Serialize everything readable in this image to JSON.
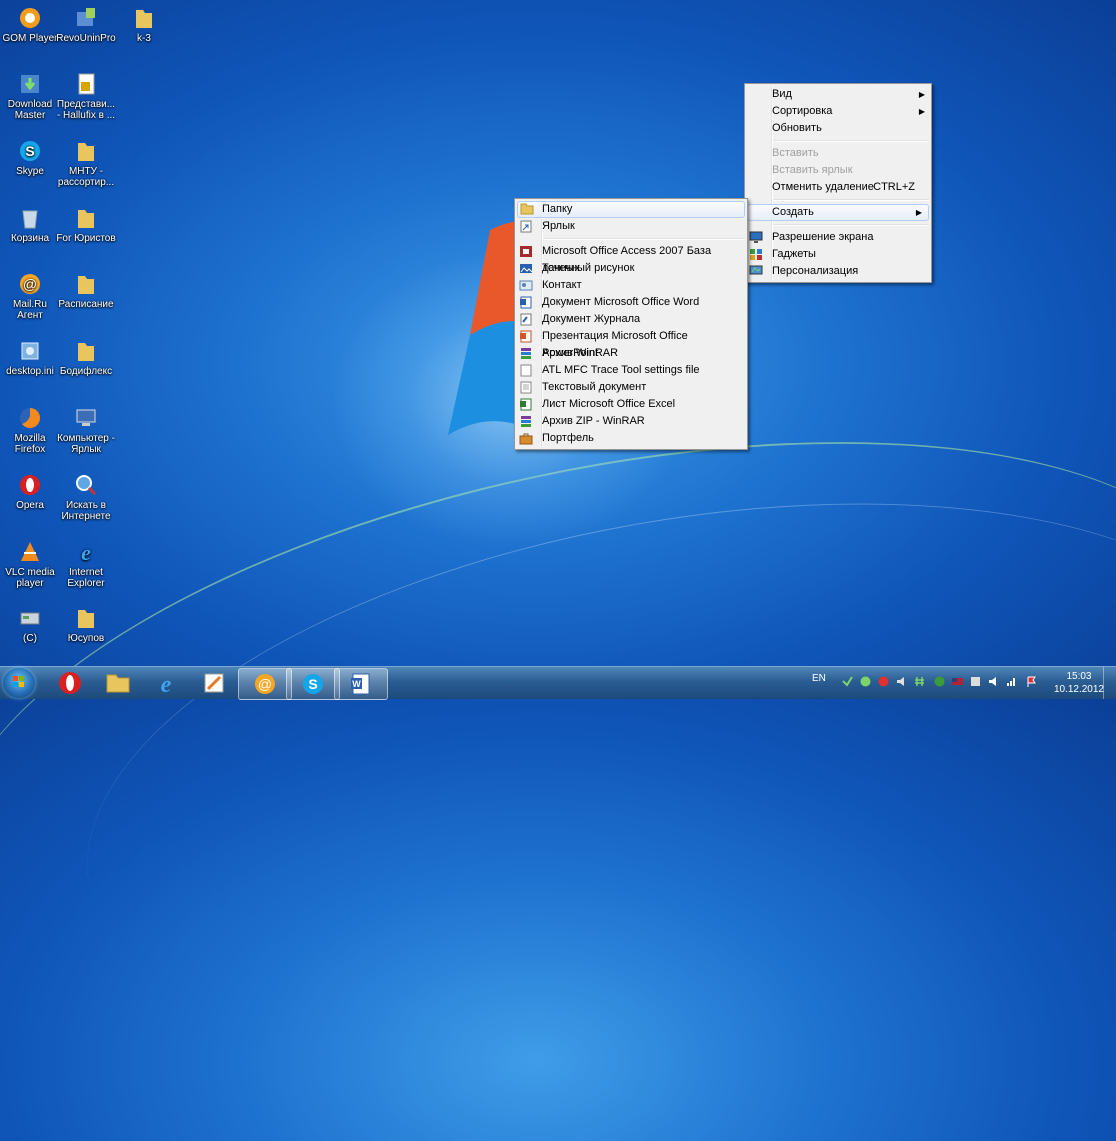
{
  "desktop": {
    "icons": [
      {
        "label": "GOM Player",
        "name": "gom-player-icon"
      },
      {
        "label": "RevoUninPro",
        "name": "revouninpro-icon"
      },
      {
        "label": "k-3",
        "name": "k3-folder-icon"
      },
      {
        "label": "Download Master",
        "name": "download-master-icon"
      },
      {
        "label": "Представи... - Hallufix в ...",
        "name": "presentation-shortcut-icon"
      },
      {
        "label": "Skype",
        "name": "skype-icon"
      },
      {
        "label": "МНТУ - рассортир...",
        "name": "mntu-folder-icon"
      },
      {
        "label": "Корзина",
        "name": "recycle-bin-icon"
      },
      {
        "label": "For Юристов",
        "name": "for-lawyers-folder-icon"
      },
      {
        "label": "Mail.Ru Агент",
        "name": "mailru-agent-icon"
      },
      {
        "label": "Расписание",
        "name": "schedule-folder-icon"
      },
      {
        "label": "desktop.ini",
        "name": "desktop-ini-icon"
      },
      {
        "label": "Бодифлекс",
        "name": "bodyflex-folder-icon"
      },
      {
        "label": "Mozilla Firefox",
        "name": "firefox-icon"
      },
      {
        "label": "Компьютер - Ярлык",
        "name": "computer-shortcut-icon"
      },
      {
        "label": "Opera",
        "name": "opera-icon"
      },
      {
        "label": "Искать в Интернете",
        "name": "search-internet-icon"
      },
      {
        "label": "VLC media player",
        "name": "vlc-icon"
      },
      {
        "label": "Internet Explorer",
        "name": "internet-explorer-icon"
      },
      {
        "label": "(C)",
        "name": "c-shortcut-icon"
      },
      {
        "label": "Юсупов",
        "name": "yusupov-folder-icon"
      }
    ]
  },
  "context_menu": {
    "items": {
      "view": "Вид",
      "sort": "Сортировка",
      "refresh": "Обновить",
      "paste": "Вставить",
      "paste_shortcut": "Вставить ярлык",
      "undo_delete": "Отменить удаление",
      "undo_shortcut": "CTRL+Z",
      "create": "Создать",
      "screen_resolution": "Разрешение экрана",
      "gadgets": "Гаджеты",
      "personalization": "Персонализация"
    }
  },
  "submenu": {
    "items": {
      "folder": "Папку",
      "shortcut": "Ярлык",
      "access": "Microsoft Office Access 2007 База данных",
      "bitmap": "Точечный рисунок",
      "contact": "Контакт",
      "word": "Документ Microsoft Office Word",
      "journal": "Документ Журнала",
      "powerpoint": "Презентация Microsoft Office PowerPoint",
      "winrar": "Архив WinRAR",
      "atl": "ATL MFC Trace Tool settings file",
      "text": "Текстовый документ",
      "excel": "Лист Microsoft Office Excel",
      "zip": "Архив ZIP - WinRAR",
      "briefcase": "Портфель"
    }
  },
  "taskbar": {
    "language": "EN",
    "time": "15:03",
    "date": "10.12.2012"
  },
  "colors": {
    "desktop_bg": "#1f73d0",
    "menu_bg": "#f0f0f0",
    "highlight_border": "#aecff7"
  }
}
